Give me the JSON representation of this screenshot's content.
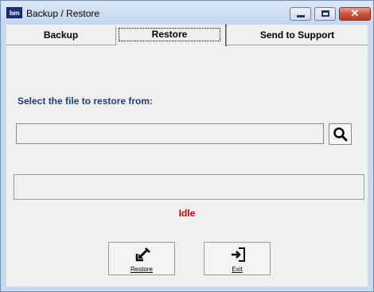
{
  "window": {
    "title": "Backup / Restore",
    "app_icon_text": "Ism"
  },
  "tabs": [
    {
      "label": "Backup",
      "active": false
    },
    {
      "label": "Restore",
      "active": true
    },
    {
      "label": "Send to Support",
      "active": false
    }
  ],
  "restore": {
    "select_label": "Select the file to restore from:",
    "file_value": "",
    "status": "Idle",
    "status_color": "#cc0000"
  },
  "buttons": {
    "restore_label": "Restore",
    "exit_label": "Exit"
  },
  "icons": {
    "browse": "search-icon",
    "restore": "restore-arrow-icon",
    "exit": "exit-icon"
  }
}
